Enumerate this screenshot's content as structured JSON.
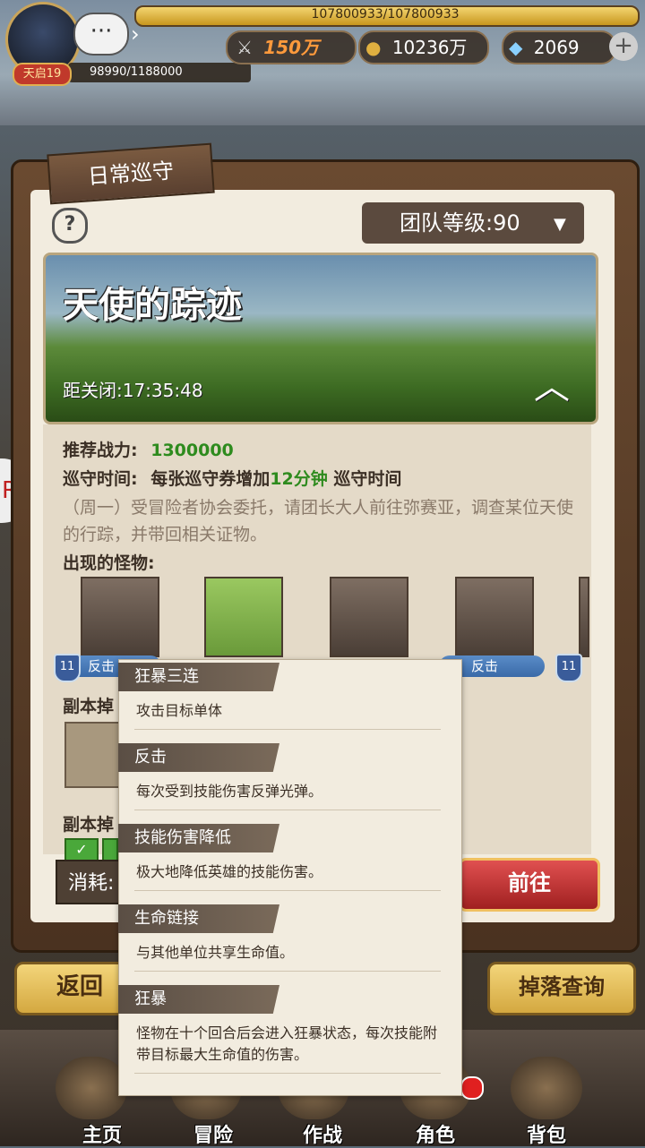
{
  "player": {
    "level_badge": "天启19",
    "exp": "98990/1188000",
    "hp_text": "107800933/107800933"
  },
  "resources": {
    "power": "150万",
    "gold": "10236万",
    "gems": "2069",
    "add_label": "+"
  },
  "panel": {
    "title": "日常巡守",
    "help_label": "?",
    "team_level": "团队等级:90",
    "banner_title": "天使的踪迹",
    "countdown": "距关闭:17:35:48",
    "rec_power_label": "推荐战力:",
    "rec_power_value": "1300000",
    "time_label": "巡守时间:",
    "time_prefix": "每张巡守券增加",
    "time_value": "12分钟",
    "time_suffix": "巡守时间",
    "description": "（周一）受冒险者协会委托，请团长大人前往弥赛亚，调查某位天使的行踪，并带回相关证物。",
    "monsters_label": "出现的怪物:",
    "monsters": [
      {
        "level": "11",
        "skill": "反击"
      },
      {
        "level": "",
        "skill": ""
      },
      {
        "level": "",
        "skill": ""
      },
      {
        "level": "",
        "skill": "反击"
      },
      {
        "level": "11",
        "skill": ""
      }
    ],
    "drops_label": "副本掉",
    "drops_label2": "副本掉",
    "cost_label": "消耗:",
    "go_label": "前往"
  },
  "buttons": {
    "back": "返回",
    "drop_query": "掉落查询"
  },
  "nav": [
    "主页",
    "冒险",
    "作战",
    "角色",
    "背包"
  ],
  "popup": [
    {
      "name": "狂暴三连",
      "desc": "攻击目标单体"
    },
    {
      "name": "反击",
      "desc": "每次受到技能伤害反弹光弹。"
    },
    {
      "name": "技能伤害降低",
      "desc": "极大地降低英雄的技能伤害。"
    },
    {
      "name": "生命链接",
      "desc": "与其他单位共享生命值。"
    },
    {
      "name": "狂暴",
      "desc": "怪物在十个回合后会进入狂暴状态，每次技能附带目标最大生命值的伤害。"
    }
  ],
  "colors": {
    "accent_gold": "#d4a840",
    "go_red": "#c03030",
    "green_text": "#2e8b1e"
  }
}
